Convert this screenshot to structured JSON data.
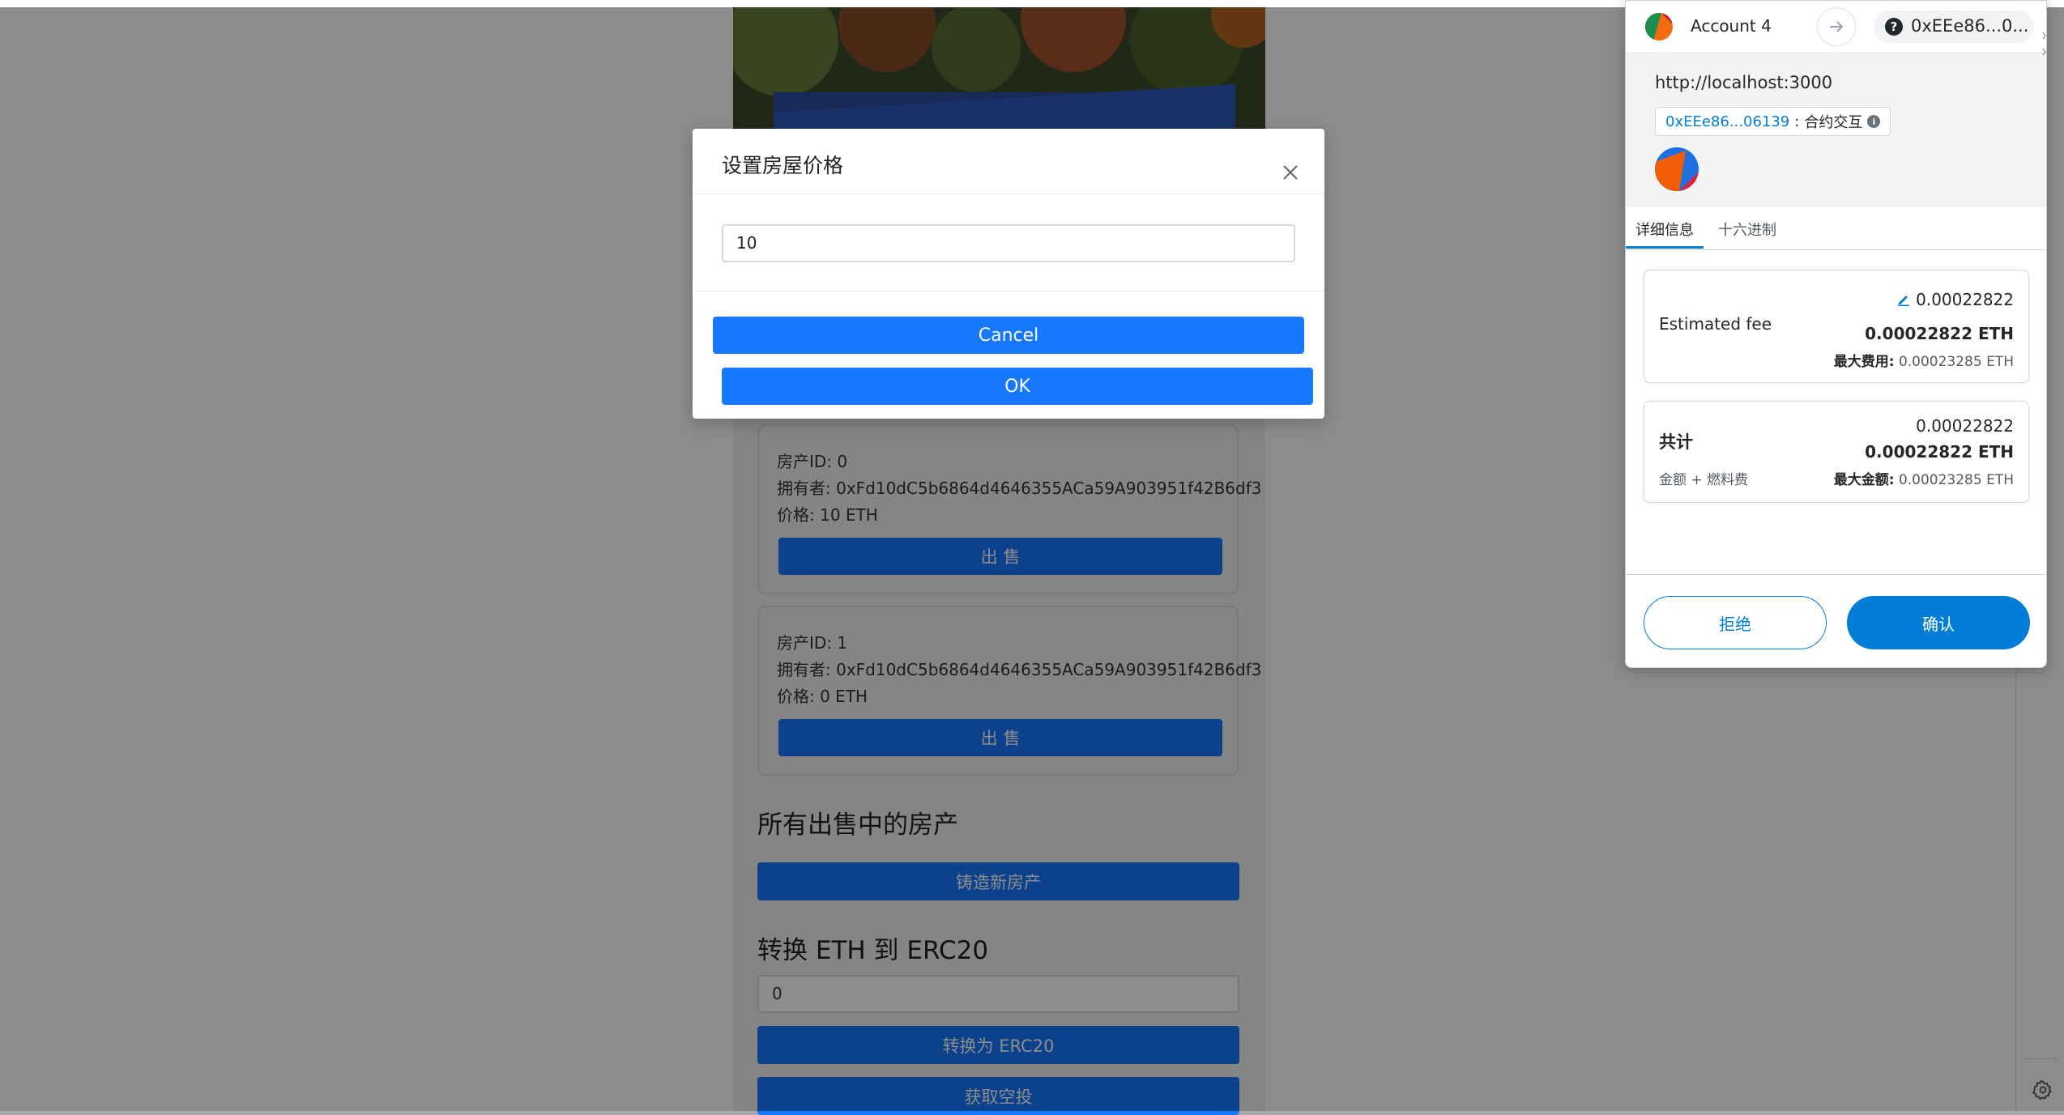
{
  "page": {
    "cards": [
      {
        "id_line": "房产ID: 0",
        "owner_line": "拥有者: 0xFd10dC5b6864d4646355ACa59A903951f42B6df3",
        "price_line": "价格: 10 ETH",
        "sell_label": "出 售"
      },
      {
        "id_line": "房产ID: 1",
        "owner_line": "拥有者: 0xFd10dC5b6864d4646355ACa59A903951f42B6df3",
        "price_line": "价格: 0 ETH",
        "sell_label": "出 售"
      }
    ],
    "for_sale_title": "所有出售中的房产",
    "mint_label": "铸造新房产",
    "convert_title": "转换 ETH 到 ERC20",
    "convert_value": "0",
    "convert_label": "转换为 ERC20",
    "airdrop_label": "获取空投"
  },
  "modal": {
    "title": "设置房屋价格",
    "price_value": "10",
    "cancel_label": "Cancel",
    "ok_label": "OK"
  },
  "wallet": {
    "account_name": "Account 4",
    "to_address": "0xEEe86...0...",
    "origin": "http://localhost:3000",
    "contract_address": "0xEEe86...06139",
    "contract_sep": ":",
    "contract_label": "合约交互",
    "tabs": [
      "详细信息",
      "十六进制"
    ],
    "estimated_fee_label": "Estimated fee",
    "estimated_fee_value": "0.00022822",
    "estimated_fee_eth": "0.00022822 ETH",
    "max_fee_label": "最大费用:",
    "max_fee_value": "0.00023285 ETH",
    "total_label": "共计",
    "total_value": "0.00022822",
    "total_eth": "0.00022822 ETH",
    "total_sub_label": "金额 + 燃料费",
    "max_amount_label": "最大金额:",
    "max_amount_value": "0.00023285 ETH",
    "reject_label": "拒绝",
    "confirm_label": "确认"
  },
  "colors": {
    "primary_blue": "#1677ff",
    "metamask_blue": "#037dd6",
    "overlay": "rgba(0,0,0,0.45)"
  },
  "icons": [
    "close-icon",
    "arrow-right-icon",
    "question-icon",
    "info-icon",
    "edit-icon",
    "gear-icon"
  ]
}
